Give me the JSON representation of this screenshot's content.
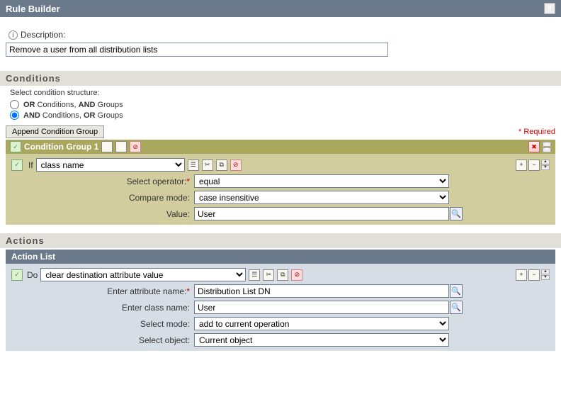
{
  "header": {
    "title": "Rule Builder"
  },
  "description": {
    "label": "Description:",
    "value": "Remove a user from all distribution lists"
  },
  "conditions": {
    "section_title": "Conditions",
    "structure_label": "Select condition structure:",
    "radio_or": "OR Conditions, AND Groups",
    "radio_and": "AND Conditions, OR Groups",
    "append_btn": "Append Condition Group",
    "required_text": "* Required",
    "group1": {
      "title": "Condition Group 1",
      "if_label": "If",
      "class_select_value": "class name",
      "operator_label": "Select operator:",
      "operator_value": "equal",
      "compare_label": "Compare mode:",
      "compare_value": "case insensitive",
      "value_label": "Value:",
      "value_value": "User"
    }
  },
  "actions": {
    "section_title": "Actions",
    "list_title": "Action List",
    "do_label": "Do",
    "action_value": "clear destination attribute value",
    "attr_name_label": "Enter attribute name:",
    "attr_name_value": "Distribution List DN",
    "class_name_label": "Enter class name:",
    "class_name_value": "User",
    "mode_label": "Select mode:",
    "mode_value": "add to current operation",
    "object_label": "Select object:",
    "object_value": "Current object"
  }
}
